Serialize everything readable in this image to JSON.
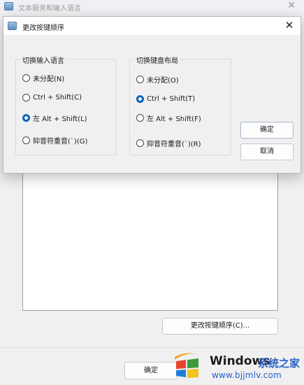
{
  "background_window": {
    "title": "文本服务和输入语言",
    "close_glyph": "✕",
    "change_hotkey_button": "更改按键顺序(C)...",
    "ok_button": "确定"
  },
  "dialog": {
    "title": "更改按键顺序",
    "close_glyph": "✕",
    "input_language_group": {
      "label": "切换输入语言",
      "options": [
        {
          "label": "未分配(N)",
          "checked": false
        },
        {
          "label": "Ctrl + Shift(C)",
          "checked": false
        },
        {
          "label": "左 Alt + Shift(L)",
          "checked": true
        },
        {
          "label": "抑音符重音(`)(G)",
          "checked": false
        }
      ]
    },
    "keyboard_layout_group": {
      "label": "切换键盘布局",
      "options": [
        {
          "label": "未分配(O)",
          "checked": false
        },
        {
          "label": "Ctrl + Shift(T)",
          "checked": true
        },
        {
          "label": "左 Alt + Shift(F)",
          "checked": false
        },
        {
          "label": "抑音符重音(`)(R)",
          "checked": false
        }
      ]
    },
    "ok_button": "确定",
    "cancel_button": "取消"
  },
  "watermark": {
    "brand": "Windows",
    "site_name": "系统之家",
    "url": "www.bjjmlv.com"
  },
  "colors": {
    "accent": "#005fb8",
    "watermark_blue": "#2a62c9"
  }
}
